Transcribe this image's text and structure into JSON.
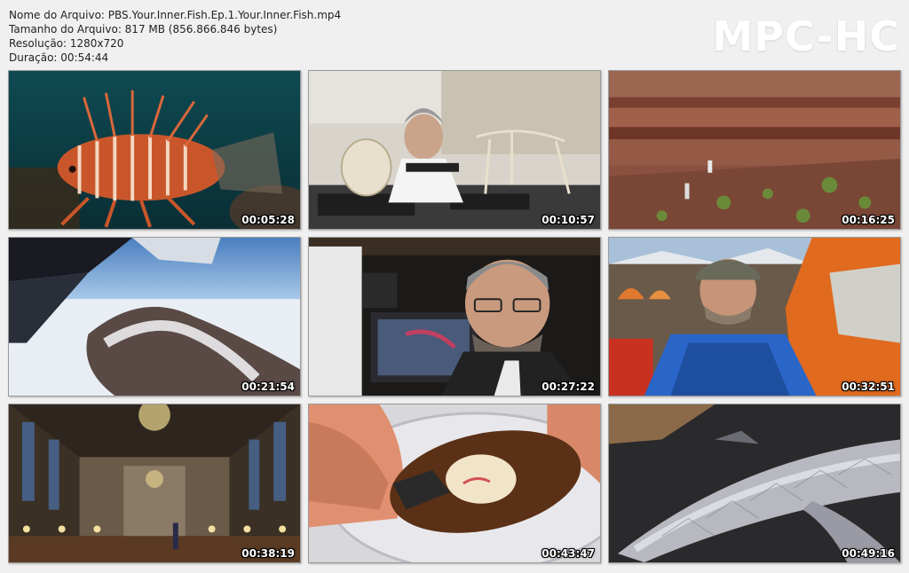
{
  "file_info": {
    "name_line": "Nome do Arquivo: PBS.Your.Inner.Fish.Ep.1.Your.Inner.Fish.mp4",
    "size_line": "Tamanho do Arquivo: 817 MB (856.866.846 bytes)",
    "resolution_line": "Resolução: 1280x720",
    "duration_line": "Duração: 00:54:44"
  },
  "logo": "MPC-HC",
  "thumbnails": [
    {
      "timestamp": "00:05:28",
      "scene": "lionfish"
    },
    {
      "timestamp": "00:10:57",
      "scene": "lab-skeletons"
    },
    {
      "timestamp": "00:16:25",
      "scene": "red-cliffs"
    },
    {
      "timestamp": "00:21:54",
      "scene": "aerial-snow"
    },
    {
      "timestamp": "00:27:22",
      "scene": "man-microscope"
    },
    {
      "timestamp": "00:32:51",
      "scene": "man-tent"
    },
    {
      "timestamp": "00:38:19",
      "scene": "gothic-hall"
    },
    {
      "timestamp": "00:43:47",
      "scene": "embryo-dish"
    },
    {
      "timestamp": "00:49:16",
      "scene": "fish-closeup"
    }
  ]
}
